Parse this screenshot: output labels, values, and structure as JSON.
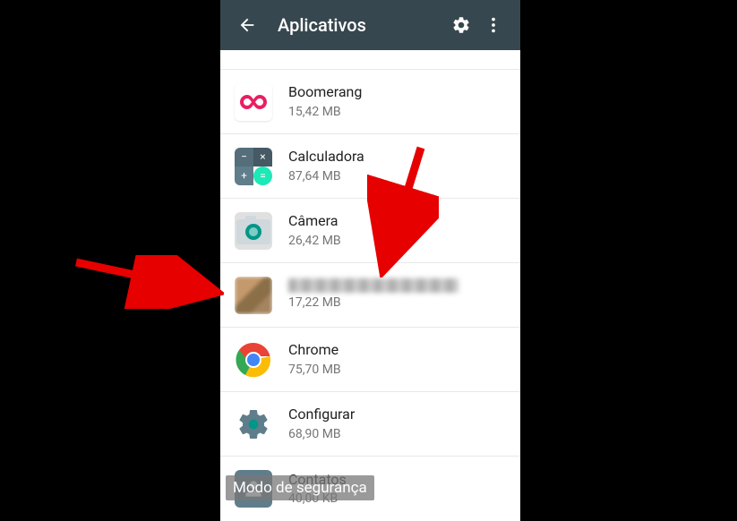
{
  "toolbar": {
    "title": "Aplicativos",
    "back_icon": "arrow-back",
    "settings_icon": "gear",
    "more_icon": "more-vert"
  },
  "apps": [
    {
      "name": "Boomerang",
      "size": "15,42 MB",
      "icon": "boomerang"
    },
    {
      "name": "Calculadora",
      "size": "87,64 MB",
      "icon": "calculator"
    },
    {
      "name": "Câmera",
      "size": "26,42 MB",
      "icon": "camera"
    },
    {
      "name": "[obscured]",
      "size": "17,22 MB",
      "icon": "blurred",
      "highlighted": true
    },
    {
      "name": "Chrome",
      "size": "75,70 MB",
      "icon": "chrome"
    },
    {
      "name": "Configurar",
      "size": "68,90 MB",
      "icon": "settings-gear"
    },
    {
      "name": "Contatos",
      "size": "40,00 KB",
      "icon": "contacts"
    }
  ],
  "overlay": {
    "safe_mode": "Modo de segurança"
  },
  "annotation": {
    "arrow_color": "#e60000"
  }
}
